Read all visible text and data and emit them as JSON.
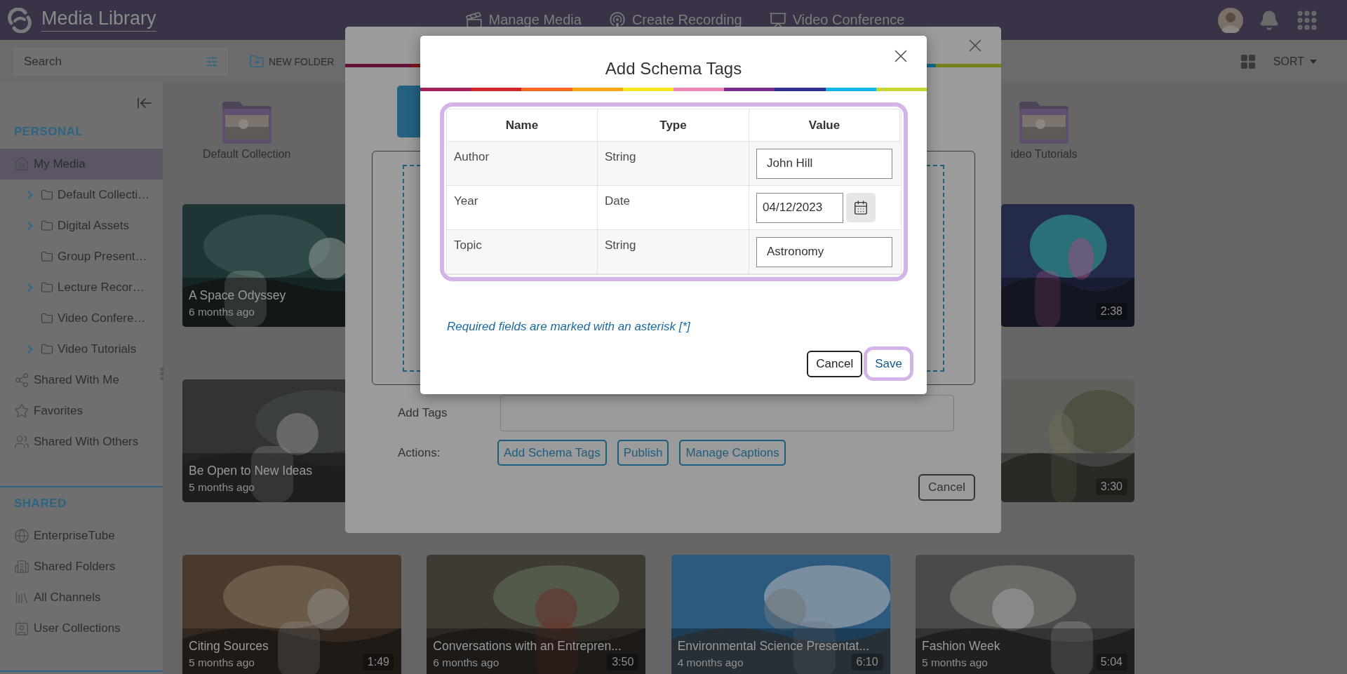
{
  "app": {
    "title": "Media Library",
    "nav": [
      {
        "label": "Manage Media"
      },
      {
        "label": "Create Recording"
      },
      {
        "label": "Video Conference"
      }
    ]
  },
  "toolbar": {
    "search": {
      "placeholder": "Search"
    },
    "new_folder": "NEW FOLDER",
    "sort": "SORT"
  },
  "sidebar": {
    "sections": [
      {
        "title": "PERSONAL",
        "items": [
          {
            "label": "My Media",
            "selected": true,
            "children": [
              {
                "label": "Default Collecti…",
                "collapsed": true,
                "selected": false
              },
              {
                "label": "Digital Assets",
                "collapsed": true,
                "selected": false
              },
              {
                "label": "Group Present…",
                "collapsed": false,
                "selected": false
              },
              {
                "label": "Lecture Recor…",
                "collapsed": true,
                "selected": false
              },
              {
                "label": "Video Confere…",
                "collapsed": false,
                "selected": false
              },
              {
                "label": "Video Tutorials",
                "collapsed": true,
                "selected": false
              }
            ]
          },
          {
            "label": "Shared With Me",
            "selected": false
          },
          {
            "label": "Favorites",
            "selected": false
          },
          {
            "label": "Shared With Others",
            "selected": false
          }
        ]
      },
      {
        "title": "SHARED",
        "items": [
          {
            "label": "EnterpriseTube",
            "selected": false
          },
          {
            "label": "Shared Folders",
            "selected": false
          },
          {
            "label": "All Channels",
            "selected": false
          },
          {
            "label": "User Collections",
            "selected": false
          }
        ]
      }
    ]
  },
  "folders": [
    {
      "label": "Default Collection"
    },
    {
      "label": "ideo Tutorials"
    }
  ],
  "cards": [
    [
      {
        "title": "A Space Odyssey",
        "age": "6 months ago"
      },
      {
        "duration": "2:38"
      }
    ],
    [
      {
        "title": "Be Open to New Ideas",
        "age": "5 months ago"
      },
      {
        "duration": "3:30"
      }
    ],
    [
      {
        "title": "Citing Sources",
        "age": "5 months ago",
        "duration": "1:49"
      },
      {
        "title": "Conversations with an Entrepren...",
        "age": "6 months ago",
        "duration": "3:50"
      },
      {
        "title": "Environmental Science Presentat...",
        "age": "4 months ago",
        "duration": "6:10"
      },
      {
        "title": "Fashion Week",
        "age": "5 months ago",
        "duration": "5:04"
      }
    ]
  ],
  "upload_dialog": {
    "add_tags_label": "Add Tags",
    "actions_label": "Actions:",
    "actions": [
      "Add Schema Tags",
      "Publish",
      "Manage Captions"
    ],
    "cancel": "Cancel"
  },
  "schema_dialog": {
    "title": "Add Schema Tags",
    "highlighted": true,
    "columns": [
      "Name",
      "Type",
      "Value"
    ],
    "rows": [
      {
        "name": "Author",
        "type": "String",
        "kind": "text",
        "value": "John Hill"
      },
      {
        "name": "Year",
        "type": "Date",
        "kind": "date",
        "value": "04/12/2023"
      },
      {
        "name": "Topic",
        "type": "String",
        "kind": "text",
        "value": "Astronomy"
      }
    ],
    "note": "Required fields are marked with an asterisk [*]",
    "cancel": "Cancel",
    "save": {
      "label": "Save",
      "highlighted": true
    }
  }
}
